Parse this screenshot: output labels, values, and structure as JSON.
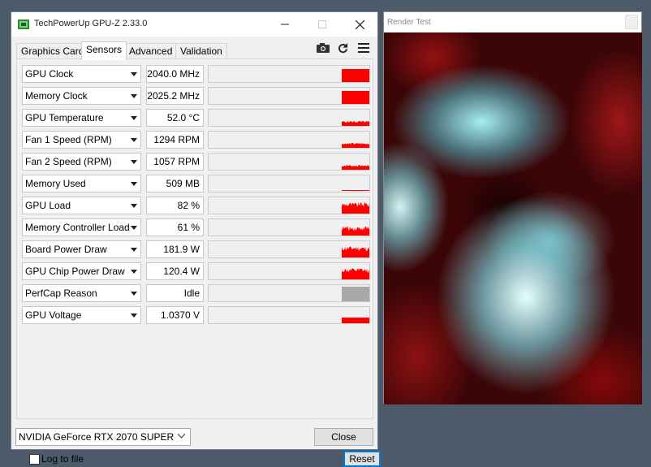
{
  "gpuz": {
    "title": "TechPowerUp GPU-Z 2.33.0",
    "tabs": [
      {
        "label": "Graphics Card",
        "active": false
      },
      {
        "label": "Sensors",
        "active": true
      },
      {
        "label": "Advanced",
        "active": false
      },
      {
        "label": "Validation",
        "active": false
      }
    ],
    "toolbar_icons": [
      "camera-icon",
      "refresh-icon",
      "menu-icon"
    ],
    "sensors": [
      {
        "name": "GPU Clock",
        "value": "2040.0 MHz",
        "graph": "block"
      },
      {
        "name": "Memory Clock",
        "value": "2025.2 MHz",
        "graph": "block"
      },
      {
        "name": "GPU Temperature",
        "value": "52.0 °C",
        "graph": "low"
      },
      {
        "name": "Fan 1 Speed (RPM)",
        "value": "1294 RPM",
        "graph": "low"
      },
      {
        "name": "Fan 2 Speed (RPM)",
        "value": "1057 RPM",
        "graph": "low"
      },
      {
        "name": "Memory Used",
        "value": "509 MB",
        "graph": "line"
      },
      {
        "name": "GPU Load",
        "value": "82 %",
        "graph": "spiky"
      },
      {
        "name": "Memory Controller Load",
        "value": "61 %",
        "graph": "spiky-low"
      },
      {
        "name": "Board Power Draw",
        "value": "181.9 W",
        "graph": "spiky"
      },
      {
        "name": "GPU Chip Power Draw",
        "value": "120.4 W",
        "graph": "spiky"
      },
      {
        "name": "PerfCap Reason",
        "value": "Idle",
        "graph": "gray"
      },
      {
        "name": "GPU Voltage",
        "value": "1.0370 V",
        "graph": "mid"
      }
    ],
    "log_to_file": {
      "label": "Log to file",
      "checked": false
    },
    "reset_label": "Reset",
    "gpu_selected": "NVIDIA GeForce RTX 2070 SUPER",
    "close_label": "Close",
    "colors": {
      "graph_fill": "#ff0000",
      "perfcap_fill": "#a9a9a9",
      "accent": "#0078d7"
    }
  },
  "render_test": {
    "title": "Render Test"
  }
}
